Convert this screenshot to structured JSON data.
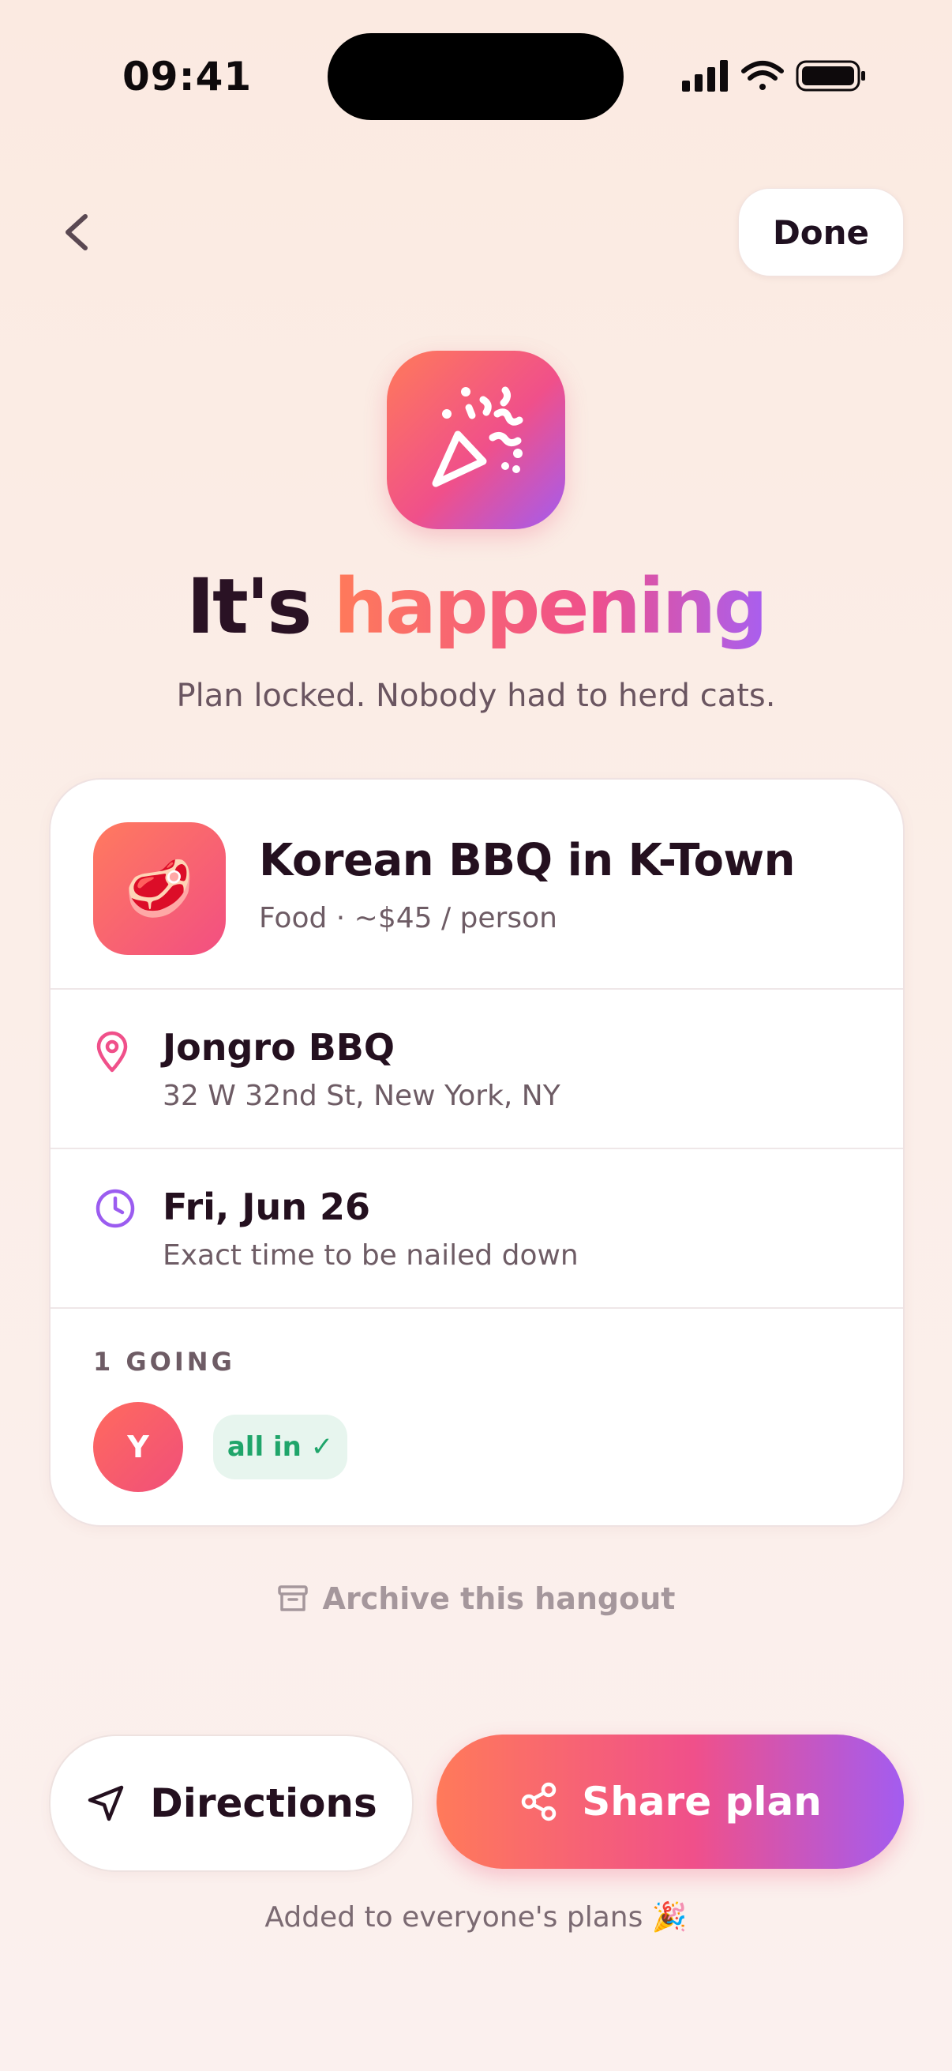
{
  "status_bar": {
    "time": "09:41"
  },
  "nav": {
    "done_label": "Done"
  },
  "hero": {
    "headline_prefix": "It's ",
    "headline_accent": "happening",
    "subhead": "Plan locked. Nobody had to herd cats."
  },
  "card": {
    "title": "Korean BBQ in K-Town",
    "subtitle": "Food · ~$45 / person",
    "food_emoji": "🥩",
    "location": {
      "name": "Jongro BBQ",
      "address": "32 W 32nd St, New York, NY"
    },
    "date": {
      "label": "Fri, Jun 26",
      "note": "Exact time to be nailed down"
    },
    "going": {
      "label": "1 GOING",
      "avatar_initial": "Y",
      "badge": "all in ✓"
    }
  },
  "archive_label": "Archive this hangout",
  "actions": {
    "directions": "Directions",
    "share": "Share plan"
  },
  "footer": "Added to everyone's plans 🎉",
  "colors": {
    "accent_start": "#ff7a5a",
    "accent_mid": "#f0508a",
    "accent_end": "#a35cf0",
    "success": "#1fa56a"
  },
  "icons": {
    "back": "chevron-left-icon",
    "app": "party-popper-icon",
    "location": "map-pin-icon",
    "time": "clock-icon",
    "archive": "archive-box-icon",
    "directions": "navigation-arrow-icon",
    "share": "share-nodes-icon"
  }
}
